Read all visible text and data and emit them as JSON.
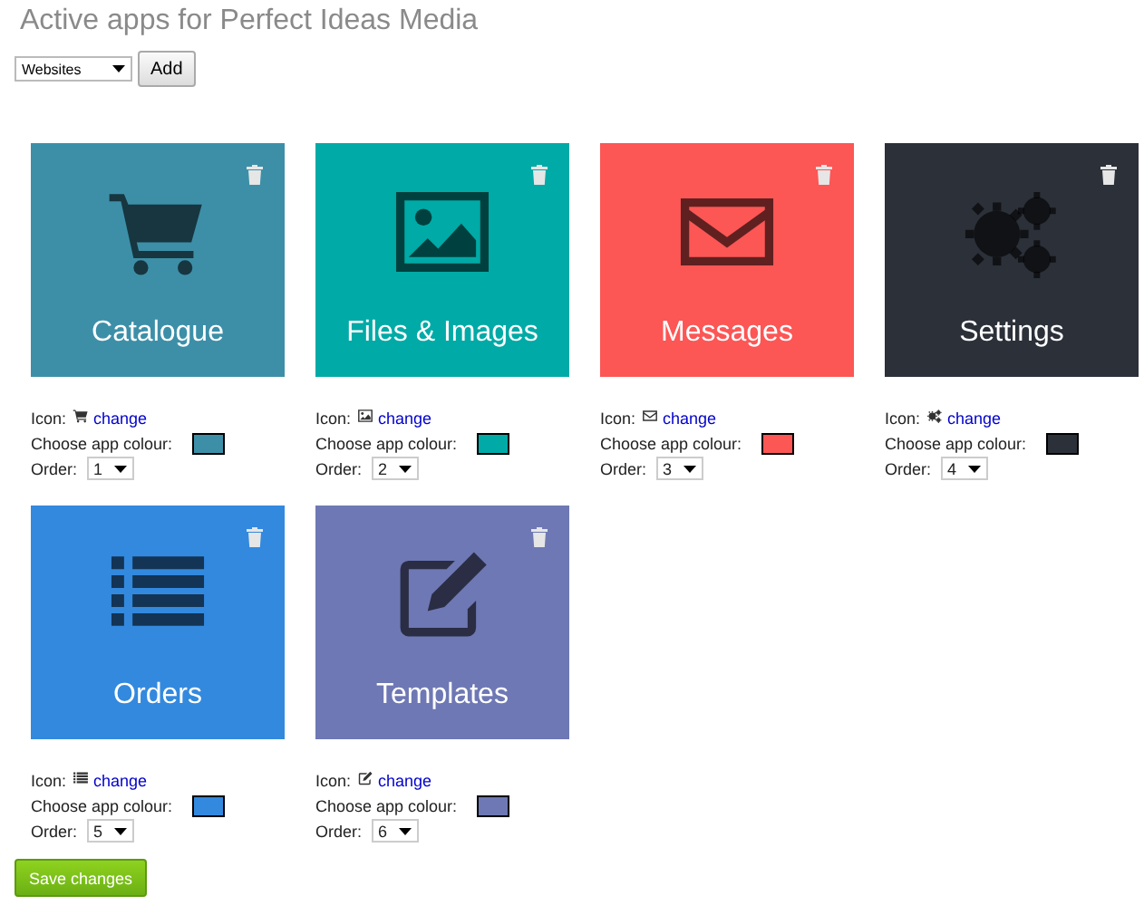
{
  "title": "Active apps for Perfect Ideas Media",
  "app_type_select": {
    "value": "Websites"
  },
  "add_button": "Add",
  "apps": [
    {
      "name": "Catalogue",
      "kind": "cart",
      "color": "#3d8fa8",
      "icon_label": "Icon:",
      "change_link": "change",
      "colour_label": "Choose app colour:",
      "order_label": "Order:",
      "order": "1"
    },
    {
      "name": "Files & Images",
      "kind": "image",
      "color": "#00aaa6",
      "icon_label": "Icon:",
      "change_link": "change",
      "colour_label": "Choose app colour:",
      "order_label": "Order:",
      "order": "2"
    },
    {
      "name": "Messages",
      "kind": "envelope",
      "color": "#fc5655",
      "icon_label": "Icon:",
      "change_link": "change",
      "colour_label": "Choose app colour:",
      "order_label": "Order:",
      "order": "3"
    },
    {
      "name": "Settings",
      "kind": "gears",
      "color": "#2b3039",
      "icon_label": "Icon:",
      "change_link": "change",
      "colour_label": "Choose app colour:",
      "order_label": "Order:",
      "order": "4"
    },
    {
      "name": "Orders",
      "kind": "list",
      "color": "#3389de",
      "icon_label": "Icon:",
      "change_link": "change",
      "colour_label": "Choose app colour:",
      "order_label": "Order:",
      "order": "5"
    },
    {
      "name": "Templates",
      "kind": "edit",
      "color": "#6e78b4",
      "icon_label": "Icon:",
      "change_link": "change",
      "colour_label": "Choose app colour:",
      "order_label": "Order:",
      "order": "6"
    }
  ],
  "save_button": "Save changes"
}
